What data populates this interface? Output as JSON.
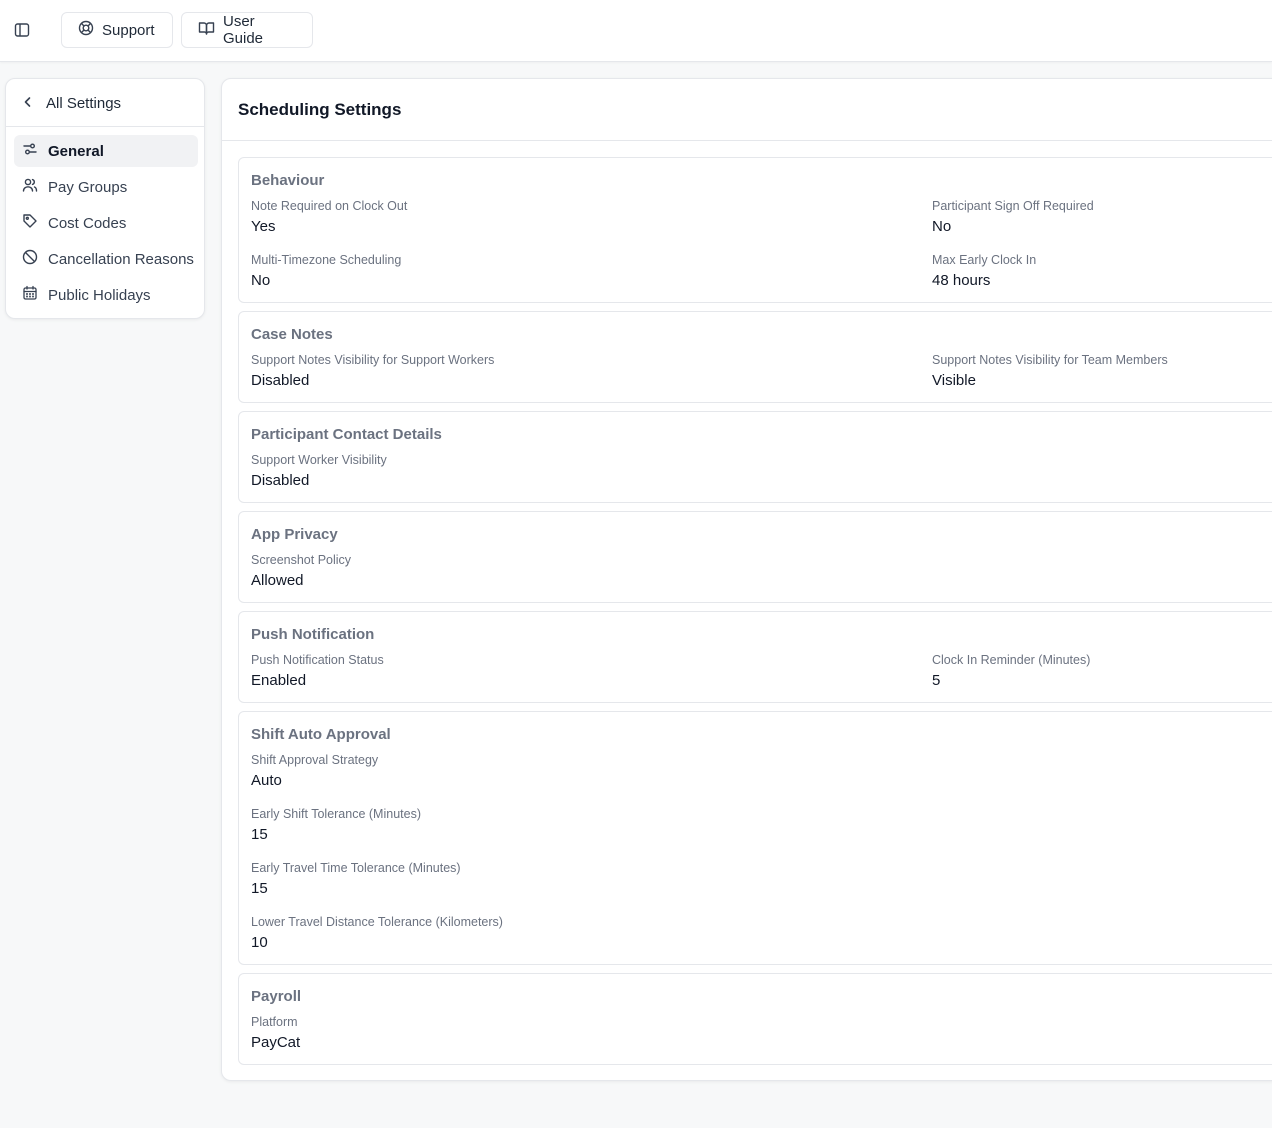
{
  "topbar": {
    "support_label": "Support",
    "guide_label": "User Guide"
  },
  "nav": {
    "back_label": "All Settings",
    "items": [
      {
        "label": "General",
        "icon": "sliders-icon",
        "active": true
      },
      {
        "label": "Pay Groups",
        "icon": "users-icon"
      },
      {
        "label": "Cost Codes",
        "icon": "tag-icon"
      },
      {
        "label": "Cancellation Reasons",
        "icon": "ban-icon"
      },
      {
        "label": "Public Holidays",
        "icon": "calendar-icon"
      }
    ]
  },
  "main": {
    "title": "Scheduling Settings",
    "sections": {
      "behaviour": {
        "title": "Behaviour",
        "note_required_label": "Note Required on Clock Out",
        "note_required_value": "Yes",
        "sign_off_label": "Participant Sign Off Required",
        "sign_off_value": "No",
        "multi_tz_label": "Multi-Timezone Scheduling",
        "multi_tz_value": "No",
        "max_early_label": "Max Early Clock In",
        "max_early_value": "48 hours"
      },
      "case_notes": {
        "title": "Case Notes",
        "sw_label": "Support Notes Visibility for Support Workers",
        "sw_value": "Disabled",
        "tm_label": "Support Notes Visibility for Team Members",
        "tm_value": "Visible"
      },
      "contact": {
        "title": "Participant Contact Details",
        "sw_label": "Support Worker Visibility",
        "sw_value": "Disabled"
      },
      "privacy": {
        "title": "App Privacy",
        "screenshot_label": "Screenshot Policy",
        "screenshot_value": "Allowed"
      },
      "push": {
        "title": "Push Notification",
        "status_label": "Push Notification Status",
        "status_value": "Enabled",
        "reminder_label": "Clock In Reminder (Minutes)",
        "reminder_value": "5"
      },
      "auto_approval": {
        "title": "Shift Auto Approval",
        "strategy_label": "Shift Approval Strategy",
        "strategy_value": "Auto",
        "early_shift_label": "Early Shift Tolerance (Minutes)",
        "early_shift_value": "15",
        "early_travel_label": "Early Travel Time Tolerance (Minutes)",
        "early_travel_value": "15",
        "lower_dist_label": "Lower Travel Distance Tolerance (Kilometers)",
        "lower_dist_value": "10"
      },
      "payroll": {
        "title": "Payroll",
        "platform_label": "Platform",
        "platform_value": "PayCat"
      }
    }
  }
}
